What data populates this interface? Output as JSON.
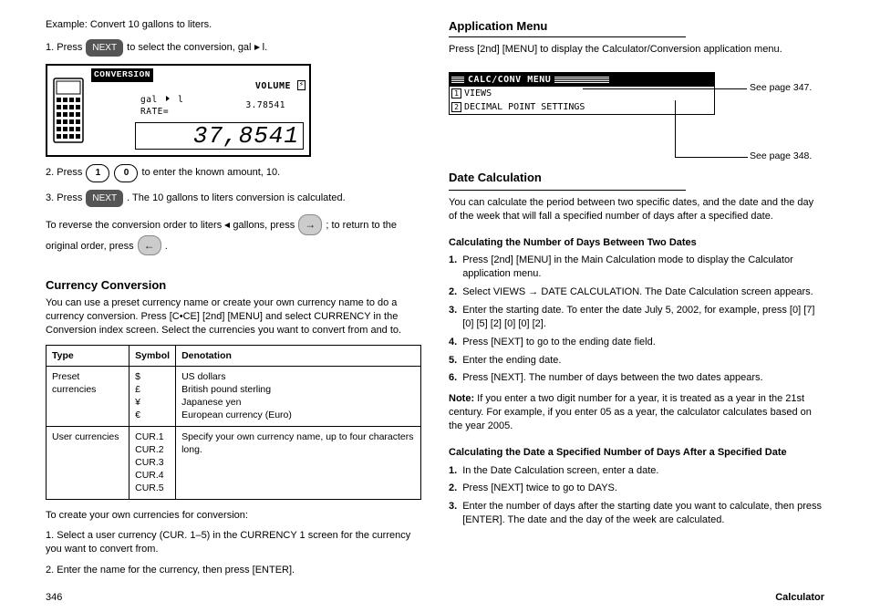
{
  "pageNumber": "346",
  "sectionTitle": "Calculator",
  "left": {
    "intro": "Example: Convert 10 gallons to liters.",
    "step1a": "1. Press ",
    "step1b": " to select the conversion, gal ",
    "step1c": " l.",
    "lcd": {
      "title": "CONVERSION",
      "category": "VOLUME",
      "unitA": "gal",
      "unitB": "l",
      "rateLabel": "RATE=",
      "rateValue": "3.78541",
      "entry": "37,8541"
    },
    "step2a": "2. Press ",
    "step2b": " to enter the known amount, 10.",
    "step3a": "3. Press ",
    "step3b": ". The 10 gallons to liters conversion is calculated.",
    "step4a": "To reverse the conversion order to liters ",
    "step4b": " gallons, press ",
    "step4c": "; to return to the original order, press ",
    "step4d": ".",
    "keys": {
      "next": "NEXT",
      "one": "1",
      "zero": "0",
      "arrR": "→",
      "arrL": "←",
      "tri": "▶",
      "triL": "◀"
    },
    "h2": "Currency Conversion",
    "currencyIntro": "You can use a preset currency name or create your own currency name to do a currency conversion. Press [C•CE] [2nd] [MENU] and select CURRENCY in the Conversion index screen. Select the currencies you want to convert from and to.",
    "tableHead": [
      "Type",
      "Symbol",
      "Denotation"
    ],
    "tableRows": [
      [
        "Preset currencies",
        "$\n£\n¥\n€",
        "US dollars\nBritish pound sterling\nJapanese yen\nEuropean currency (Euro)"
      ],
      [
        "User currencies",
        "CUR.1\nCUR.2\nCUR.3\nCUR.4\nCUR.5",
        "Specify your own currency name, up to four characters long."
      ]
    ],
    "userIntro": "To create your own currencies for conversion:",
    "userStep1": "1. Select a user currency (CUR. 1–5) in the CURRENCY 1 screen for the currency you want to convert from.",
    "userStep2": "2. Enter the name for the currency, then press [ENTER]."
  },
  "right": {
    "title": "Application Menu",
    "intro": "Press [2nd] [MENU] to display the Calculator/Conversion application menu.",
    "menu": {
      "bar": "CALC/CONV MENU",
      "item1": "VIEWS",
      "item2": "DECIMAL POINT SETTINGS"
    },
    "call1": "See page 347.",
    "call2": "See page 348.",
    "h2": "Date Calculation",
    "dateIntro": "You can calculate the period between two specific dates, and the date and the day of the week that will fall a specified number of days after a specified date.",
    "b1h": "Calculating the Number of Days Between Two Dates",
    "b1_1": "Press [2nd] [MENU] in the Main Calculation mode to display the Calculator application menu.",
    "b1_2": "Select VIEWS → DATE CALCULATION. The Date Calculation screen appears.",
    "b1_3": "Enter the starting date. To enter the date July 5, 2002, for example, press [0] [7] [0] [5] [2] [0] [0] [2].",
    "b1_4": "Press [NEXT] to go to the ending date field.",
    "b1_5": "Enter the ending date.",
    "b1_6": "Press [NEXT]. The number of days between the two dates appears.",
    "noteLabel": "Note: ",
    "noteText": "If you enter a two digit number for a year, it is treated as a year in the 21st century. For example, if you enter 05 as a year, the calculator calculates based on the year 2005.",
    "b2h": "Calculating the Date a Specified Number of Days After a Specified Date",
    "b2_1": "In the Date Calculation screen, enter a date.",
    "b2_2": "Press [NEXT] twice to go to DAYS.",
    "b2_3": "Enter the number of days after the starting date you want to calculate, then press [ENTER]. The date and the day of the week are calculated."
  }
}
